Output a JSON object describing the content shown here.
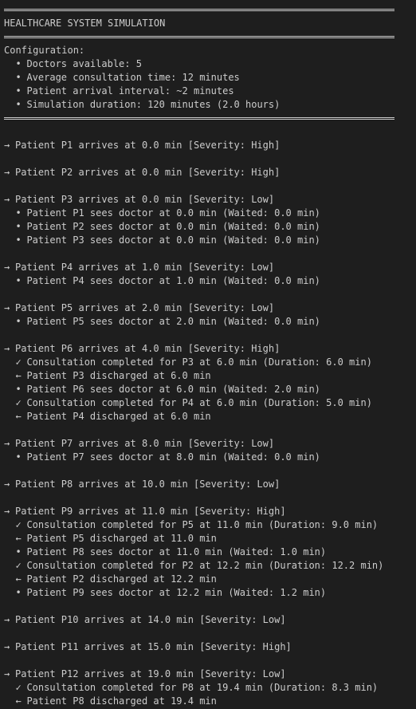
{
  "title": "HEALTHCARE SYSTEM SIMULATION",
  "config": {
    "heading": "Configuration:",
    "items": [
      "Doctors available: 5",
      "Average consultation time: 12 minutes",
      "Patient arrival interval: ~2 minutes",
      "Simulation duration: 120 minutes (2.0 hours)"
    ]
  },
  "symbols": {
    "arrive": "→",
    "sees": "•",
    "complete": "✓",
    "discharge": "←"
  },
  "log": [
    {
      "type": "blank"
    },
    {
      "type": "arrive",
      "text": "Patient P1 arrives at 0.0 min [Severity: High]"
    },
    {
      "type": "blank"
    },
    {
      "type": "arrive",
      "text": "Patient P2 arrives at 0.0 min [Severity: High]"
    },
    {
      "type": "blank"
    },
    {
      "type": "arrive",
      "text": "Patient P3 arrives at 0.0 min [Severity: Low]"
    },
    {
      "type": "sees",
      "text": "Patient P1 sees doctor at 0.0 min (Waited: 0.0 min)"
    },
    {
      "type": "sees",
      "text": "Patient P2 sees doctor at 0.0 min (Waited: 0.0 min)"
    },
    {
      "type": "sees",
      "text": "Patient P3 sees doctor at 0.0 min (Waited: 0.0 min)"
    },
    {
      "type": "blank"
    },
    {
      "type": "arrive",
      "text": "Patient P4 arrives at 1.0 min [Severity: Low]"
    },
    {
      "type": "sees",
      "text": "Patient P4 sees doctor at 1.0 min (Waited: 0.0 min)"
    },
    {
      "type": "blank"
    },
    {
      "type": "arrive",
      "text": "Patient P5 arrives at 2.0 min [Severity: Low]"
    },
    {
      "type": "sees",
      "text": "Patient P5 sees doctor at 2.0 min (Waited: 0.0 min)"
    },
    {
      "type": "blank"
    },
    {
      "type": "arrive",
      "text": "Patient P6 arrives at 4.0 min [Severity: High]"
    },
    {
      "type": "complete",
      "text": "Consultation completed for P3 at 6.0 min (Duration: 6.0 min)"
    },
    {
      "type": "discharge",
      "text": "Patient P3 discharged at 6.0 min"
    },
    {
      "type": "sees",
      "text": "Patient P6 sees doctor at 6.0 min (Waited: 2.0 min)"
    },
    {
      "type": "complete",
      "text": "Consultation completed for P4 at 6.0 min (Duration: 5.0 min)"
    },
    {
      "type": "discharge",
      "text": "Patient P4 discharged at 6.0 min"
    },
    {
      "type": "blank"
    },
    {
      "type": "arrive",
      "text": "Patient P7 arrives at 8.0 min [Severity: Low]"
    },
    {
      "type": "sees",
      "text": "Patient P7 sees doctor at 8.0 min (Waited: 0.0 min)"
    },
    {
      "type": "blank"
    },
    {
      "type": "arrive",
      "text": "Patient P8 arrives at 10.0 min [Severity: Low]"
    },
    {
      "type": "blank"
    },
    {
      "type": "arrive",
      "text": "Patient P9 arrives at 11.0 min [Severity: High]"
    },
    {
      "type": "complete",
      "text": "Consultation completed for P5 at 11.0 min (Duration: 9.0 min)"
    },
    {
      "type": "discharge",
      "text": "Patient P5 discharged at 11.0 min"
    },
    {
      "type": "sees",
      "text": "Patient P8 sees doctor at 11.0 min (Waited: 1.0 min)"
    },
    {
      "type": "complete",
      "text": "Consultation completed for P2 at 12.2 min (Duration: 12.2 min)"
    },
    {
      "type": "discharge",
      "text": "Patient P2 discharged at 12.2 min"
    },
    {
      "type": "sees",
      "text": "Patient P9 sees doctor at 12.2 min (Waited: 1.2 min)"
    },
    {
      "type": "blank"
    },
    {
      "type": "arrive",
      "text": "Patient P10 arrives at 14.0 min [Severity: Low]"
    },
    {
      "type": "blank"
    },
    {
      "type": "arrive",
      "text": "Patient P11 arrives at 15.0 min [Severity: High]"
    },
    {
      "type": "blank"
    },
    {
      "type": "arrive",
      "text": "Patient P12 arrives at 19.0 min [Severity: Low]"
    },
    {
      "type": "complete",
      "text": "Consultation completed for P8 at 19.4 min (Duration: 8.3 min)"
    },
    {
      "type": "discharge",
      "text": "Patient P8 discharged at 19.4 min"
    }
  ]
}
